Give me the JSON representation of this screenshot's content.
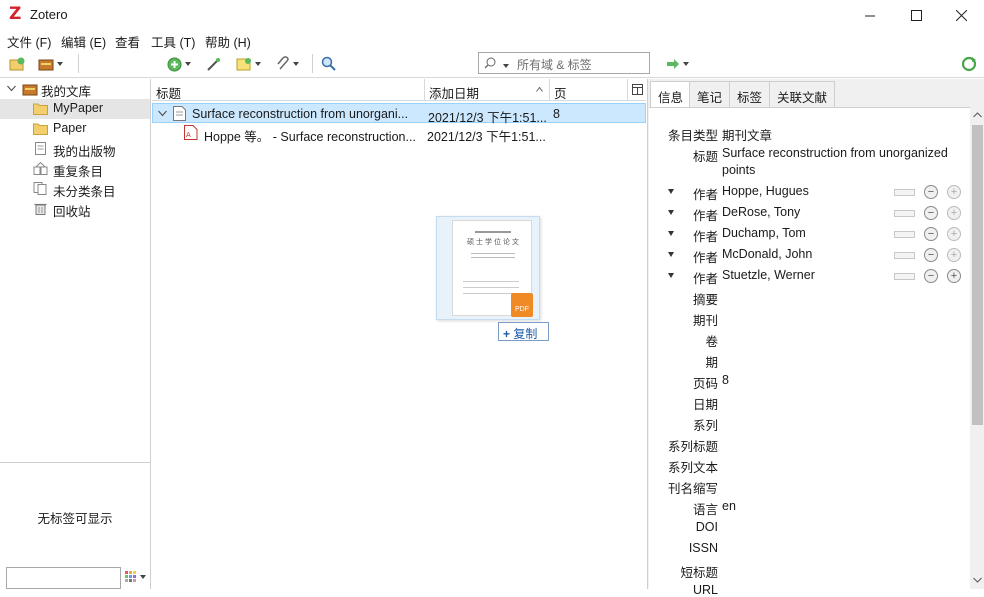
{
  "window": {
    "title": "Zotero",
    "logo": "Z"
  },
  "menubar": {
    "items": [
      "文件 (F)",
      "编辑 (E)",
      "查看",
      "工具 (T)",
      "帮助 (H)"
    ]
  },
  "toolbar": {
    "search_placeholder": "所有域 & 标签",
    "icons": [
      "new-collection-icon",
      "new-library-icon",
      "new-item-icon",
      "wand-icon",
      "new-note-icon",
      "attachment-icon",
      "advanced-search-icon",
      "locate-icon",
      "sync-icon"
    ]
  },
  "library_tree": {
    "items": [
      {
        "label": "我的文库",
        "icon": "library-icon",
        "expanded": true
      },
      {
        "label": "MyPaper",
        "icon": "folder-icon",
        "selected": true
      },
      {
        "label": "Paper",
        "icon": "folder-icon"
      },
      {
        "label": "我的出版物",
        "icon": "publications-icon"
      },
      {
        "label": "重复条目",
        "icon": "duplicates-icon"
      },
      {
        "label": "未分类条目",
        "icon": "unfiled-icon"
      },
      {
        "label": "回收站",
        "icon": "trash-icon"
      }
    ]
  },
  "tag_selector": {
    "empty_text": "无标签可显示"
  },
  "items_table": {
    "columns": [
      "标题",
      "添加日期",
      "页"
    ],
    "rows": [
      {
        "title": "Surface reconstruction from unorgani...",
        "date": "2021/12/3 下午1:51...",
        "pages": "8",
        "selected": true,
        "type": "journal-article"
      },
      {
        "title": "Hoppe 等。 - Surface reconstruction...",
        "date": "2021/12/3 下午1:51...",
        "pages": "",
        "type": "pdf-attachment"
      }
    ]
  },
  "drag": {
    "copy_label": "复制",
    "page_lines": [
      "硕士学位论文"
    ],
    "badge": "PDF"
  },
  "item_pane": {
    "tabs": [
      "信息",
      "笔记",
      "标签",
      "关联文献"
    ],
    "active_tab": "信息",
    "fields": {
      "item_type": {
        "label": "条目类型",
        "value": "期刊文章"
      },
      "title": {
        "label": "标题",
        "value_line1": "Surface reconstruction from unorganized",
        "value_line2": "points"
      },
      "creators": [
        {
          "role": "作者",
          "name": "Hoppe, Hugues"
        },
        {
          "role": "作者",
          "name": "DeRose, Tony"
        },
        {
          "role": "作者",
          "name": "Duchamp, Tom"
        },
        {
          "role": "作者",
          "name": "McDonald, John"
        },
        {
          "role": "作者",
          "name": "Stuetzle, Werner"
        }
      ],
      "abstract": {
        "label": "摘要",
        "value": ""
      },
      "publication": {
        "label": "期刊",
        "value": ""
      },
      "volume": {
        "label": "卷",
        "value": ""
      },
      "issue": {
        "label": "期",
        "value": ""
      },
      "pages": {
        "label": "页码",
        "value": "8"
      },
      "date": {
        "label": "日期",
        "value": ""
      },
      "series": {
        "label": "系列",
        "value": ""
      },
      "series_title": {
        "label": "系列标题",
        "value": ""
      },
      "series_text": {
        "label": "系列文本",
        "value": ""
      },
      "journal_abbr": {
        "label": "刊名缩写",
        "value": ""
      },
      "language": {
        "label": "语言",
        "value": "en"
      },
      "doi": {
        "label": "DOI",
        "value": ""
      },
      "issn": {
        "label": "ISSN",
        "value": ""
      },
      "short_title": {
        "label": "短标题",
        "value": ""
      },
      "url": {
        "label": "URL",
        "value": ""
      }
    }
  },
  "colors": {
    "accent": "#d3232a",
    "selection": "#cce8ff",
    "selection_border": "#99d1ff",
    "link": "#1e5aa8"
  }
}
